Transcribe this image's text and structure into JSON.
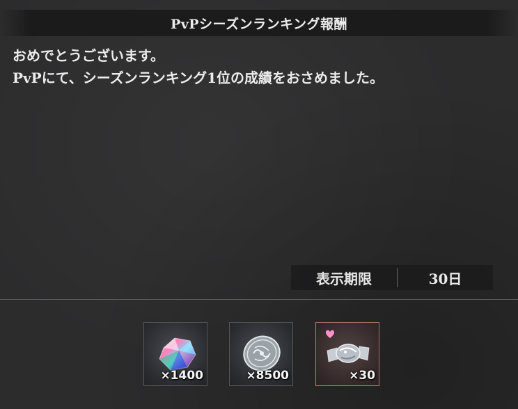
{
  "header": {
    "title": "PvPシーズンランキング報酬"
  },
  "message": {
    "line1": "おめでとうございます。",
    "line2": "PvPにて、シーズンランキング1位の成績をおさめました。"
  },
  "expiry": {
    "label": "表示期限",
    "value": "30日"
  },
  "rewards": [
    {
      "icon": "rainbow-crystal-icon",
      "quantity": "×1400"
    },
    {
      "icon": "silver-coin-icon",
      "quantity": "×8500"
    },
    {
      "icon": "wrapped-candy-icon",
      "quantity": "×30",
      "badge": "heart-icon"
    }
  ],
  "colors": {
    "background": "#2c2c2d",
    "header_bar": "#1b1b1c",
    "special_border": "#b07a6f",
    "heart": "#ff8fc8"
  }
}
